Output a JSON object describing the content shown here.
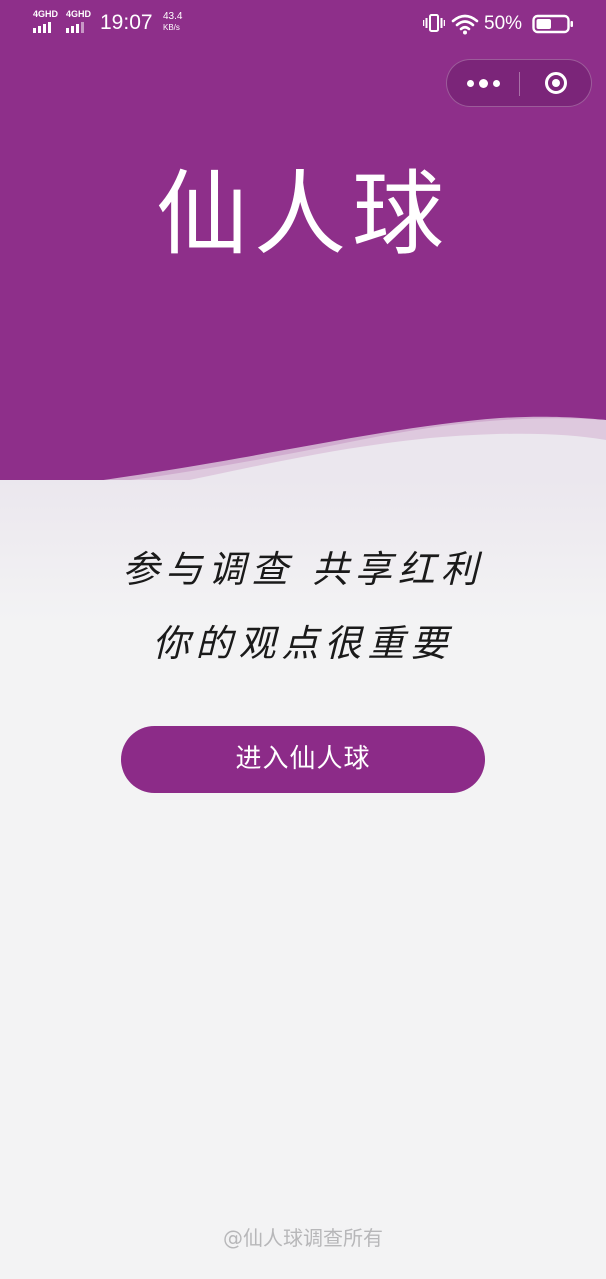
{
  "status_bar": {
    "network_1": "4GHD",
    "network_2": "4GHD",
    "time": "19:07",
    "speed_value": "43.4",
    "speed_unit": "KB/s",
    "battery_percent": "50%",
    "battery_level": 0.5,
    "icons": [
      "signal-icon",
      "vibrate-icon",
      "wifi-icon",
      "battery-icon"
    ]
  },
  "capsule": {
    "icons": [
      "more-dots-icon",
      "close-target-icon"
    ]
  },
  "hero": {
    "logo_text": "仙人球"
  },
  "slogans": {
    "line_1": "参与调查 共享红利",
    "line_2": "你的观点很重要"
  },
  "enter_button": {
    "label": "进入仙人球"
  },
  "footer": {
    "text": "@仙人球调查所有"
  },
  "colors": {
    "brand_purple": "#8e2f8a",
    "button_purple": "#8c2b88",
    "background": "#f3f3f4",
    "wave_light": "#dcc3db",
    "footer_text": "#b7b7b9"
  }
}
